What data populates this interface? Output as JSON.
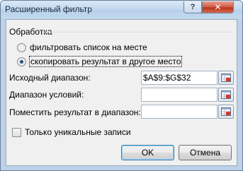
{
  "window": {
    "title": "Расширенный фильтр",
    "help_label": "?",
    "close_label": "✕"
  },
  "processing": {
    "group_label": "Обработка",
    "options": [
      {
        "label": "фильтровать список на месте",
        "checked": false
      },
      {
        "label": "скопировать результат в другое место",
        "checked": true
      }
    ]
  },
  "fields": {
    "source_range": {
      "label": "Исходный диапазон:",
      "value": "$A$9:$G$32"
    },
    "criteria_range": {
      "label": "Диапазон условий:",
      "value": ""
    },
    "copy_to": {
      "label": "Поместить результат в диапазон:",
      "value": ""
    }
  },
  "unique_only": {
    "label": "Только уникальные записи",
    "checked": false
  },
  "buttons": {
    "ok": "OK",
    "cancel": "Отмена"
  },
  "colors": {
    "accent": "#24507e",
    "close": "#c9462e",
    "frame": "#bcd2ea"
  },
  "icons": {
    "ref": "range-select-icon"
  }
}
